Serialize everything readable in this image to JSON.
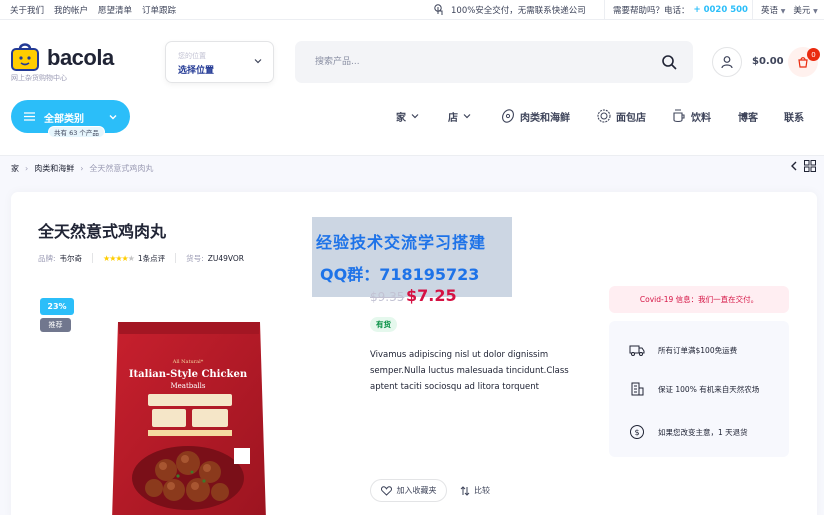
{
  "topbar": {
    "links": [
      "关于我们",
      "我的帐户",
      "愿望清单",
      "订单跟踪"
    ],
    "security_text": "100%安全交付，无需联系快递公司",
    "help_text": "需要帮助吗？电话：",
    "phone": "+ 0020 500",
    "language": "英语",
    "currency": "美元"
  },
  "logo": {
    "brand": "bacola",
    "tagline": "网上杂货购物中心"
  },
  "location": {
    "label": "您的位置",
    "value": "选择位置"
  },
  "search": {
    "placeholder": "搜索产品..."
  },
  "cart": {
    "total": "$0.00",
    "count": "0"
  },
  "all_categories": {
    "label": "全部类别",
    "count": "共有 63 个产品"
  },
  "nav": {
    "home": "家",
    "shop": "店",
    "meat": "肉类和海鲜",
    "bakery": "面包店",
    "drinks": "饮料",
    "blog": "博客",
    "contact": "联系"
  },
  "breadcrumb": {
    "home": "家",
    "category": "肉类和海鲜",
    "current": "全天然意式鸡肉丸"
  },
  "product": {
    "title": "全天然意式鸡肉丸",
    "brand_label": "品牌:",
    "brand": "韦尔奇",
    "rating": 4,
    "reviews": "1条点评",
    "sku_label": "货号:",
    "sku": "ZU49VOR",
    "discount": "23%",
    "recommended": "推荐",
    "package_line1": "All Natural*",
    "package_line2": "Italian-Style Chicken",
    "package_line3": "Meatballs",
    "old_price": "$9.35",
    "new_price": "$7.25",
    "stock": "有货",
    "description": "Vivamus adipiscing nisl ut dolor dignissim semper.Nulla luctus malesuada tincidunt.Class aptent taciti sociosqu ad litora torquent",
    "wishlist": "加入收藏夹",
    "compare": "比较"
  },
  "watermark": {
    "line1": "经验技术交流学习搭建",
    "line2": "QQ群：718195723"
  },
  "covid": "Covid-19 信息：我们一直在交付。",
  "features": [
    "所有订单满$100免运费",
    "保证 100% 有机来自天然农场",
    "如果您改变主意，1 天退货"
  ],
  "colors": {
    "accent": "#2bbef9",
    "price": "#d51243",
    "stock": "#038e42",
    "cart_badge": "#ea2b0f"
  }
}
